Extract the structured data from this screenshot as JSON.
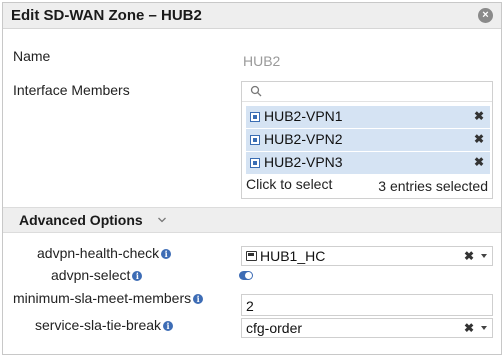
{
  "window": {
    "title": "Edit SD-WAN Zone – HUB2"
  },
  "form": {
    "name_label": "Name",
    "name_value": "HUB2",
    "members_label": "Interface Members",
    "members": [
      "HUB2-VPN1",
      "HUB2-VPN2",
      "HUB2-VPN3"
    ],
    "click_to_select": "Click to select",
    "entries_selected": "3 entries selected"
  },
  "advanced": {
    "title": "Advanced Options",
    "health_check_label": "advpn-health-check",
    "health_check_value": "HUB1_HC",
    "advpn_select_label": "advpn-select",
    "advpn_select_enabled": true,
    "min_sla_label": "minimum-sla-meet-members",
    "min_sla_value": "2",
    "tie_break_label": "service-sla-tie-break",
    "tie_break_value": "cfg-order"
  },
  "icons": {
    "close": "close-icon",
    "search": "search-icon",
    "interface": "interface-icon",
    "remove": "remove-icon",
    "chevron": "chevron-down-icon",
    "info": "info-icon",
    "health_check": "health-check-icon"
  },
  "colors": {
    "accent": "#3d6cb5",
    "selected_bg": "#d5e3f3",
    "header_bg": "#eeeeee"
  }
}
